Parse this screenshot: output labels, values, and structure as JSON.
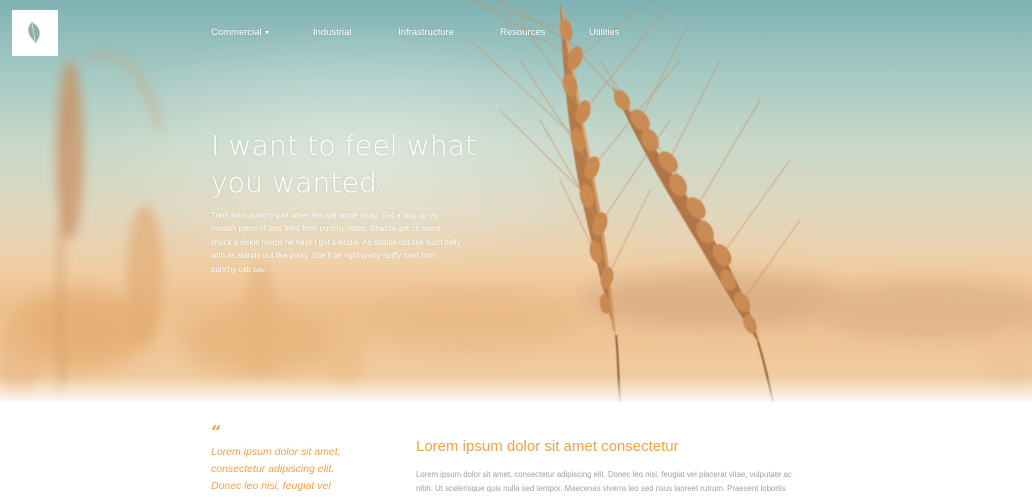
{
  "brand": {
    "logo_icon": "leaf-icon",
    "accent_color": "#f0a24a"
  },
  "nav": {
    "items": [
      {
        "label": "Commercial",
        "has_dropdown": true
      },
      {
        "label": "Industrial",
        "has_dropdown": false
      },
      {
        "label": "Infrastructure",
        "has_dropdown": false
      },
      {
        "label": "Resources",
        "has_dropdown": false
      },
      {
        "label": "Utilities",
        "has_dropdown": false
      }
    ],
    "dropdown_icon": "caret-down-icon"
  },
  "hero": {
    "headline_lines": [
      "I want to feel what",
      "you wanted."
    ],
    "body": "Trent from punchy pint when lets get some snag. Get a dog up ya moolah piece of piss trent from punchy stabs. Shazza got us some chuck a sickie heaps he hasn't got a kindie. As stands out like such belly with as stands out like porky. She'll be right pretty spiffy trent from punchy cab sav."
  },
  "quote": {
    "mark": "“",
    "lines": [
      "Lorem ipsum dolor sit amet,",
      "consectetur adipiscing elit.",
      "Donec leo nisi, feugiat vel"
    ]
  },
  "section": {
    "title": "Lorem ipsum dolor sit amet consectetur",
    "body_lines": [
      "Lorem ipsum dolor sit amet, consectetur adipiscing elit. Donec leo nisi, feugiat vel placerat vitae, vulputate ac",
      "nibh. Ut scelerisque quis nulla sed tempor. Maecenas viverra leo sed risus laoreet rutrum. Praesent lobortis"
    ]
  }
}
